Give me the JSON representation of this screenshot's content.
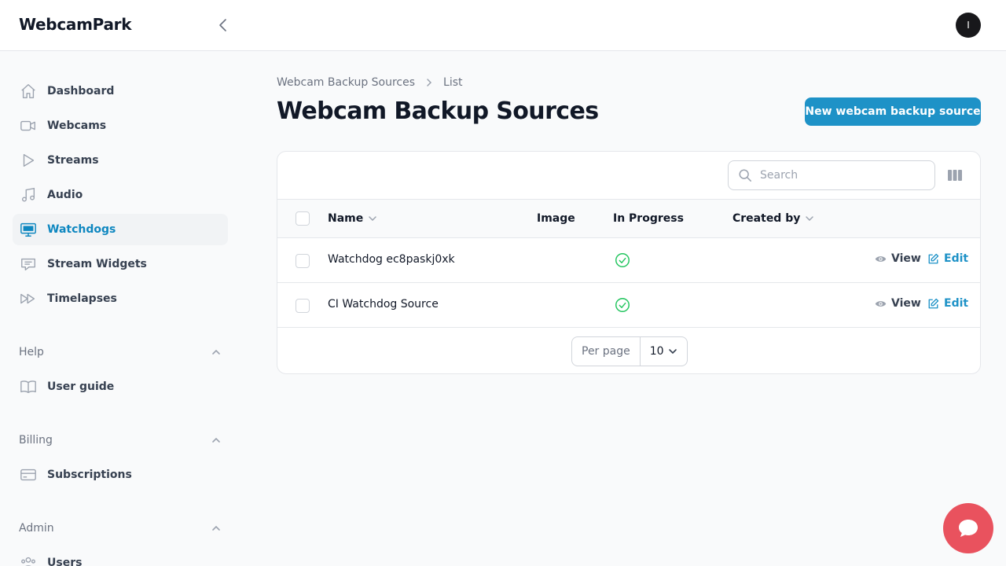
{
  "app": {
    "brand": "WebcamPark",
    "avatar_initial": "I"
  },
  "sidebar": {
    "items": [
      {
        "label": "Dashboard"
      },
      {
        "label": "Webcams"
      },
      {
        "label": "Streams"
      },
      {
        "label": "Audio"
      },
      {
        "label": "Watchdogs",
        "active": true
      },
      {
        "label": "Stream Widgets"
      },
      {
        "label": "Timelapses"
      }
    ],
    "groups": [
      {
        "label": "Help",
        "items": [
          {
            "label": "User guide"
          }
        ]
      },
      {
        "label": "Billing",
        "items": [
          {
            "label": "Subscriptions"
          }
        ]
      },
      {
        "label": "Admin",
        "items": [
          {
            "label": "Users"
          }
        ]
      }
    ]
  },
  "breadcrumb": {
    "parent": "Webcam Backup Sources",
    "current": "List"
  },
  "page": {
    "title": "Webcam Backup Sources",
    "new_button": "New webcam backup source"
  },
  "table": {
    "search_placeholder": "Search",
    "columns": {
      "name": "Name",
      "image": "Image",
      "in_progress": "In Progress",
      "created_by": "Created by"
    },
    "rows": [
      {
        "name": "Watchdog ec8paskj0xk",
        "view": "View",
        "edit": "Edit"
      },
      {
        "name": "CI Watchdog Source",
        "view": "View",
        "edit": "Edit"
      }
    ],
    "pagination": {
      "per_page_label": "Per page",
      "per_page_value": "10"
    }
  },
  "colors": {
    "accent": "#1e92c7",
    "success": "#22c55e",
    "chat": "#e9525e"
  }
}
